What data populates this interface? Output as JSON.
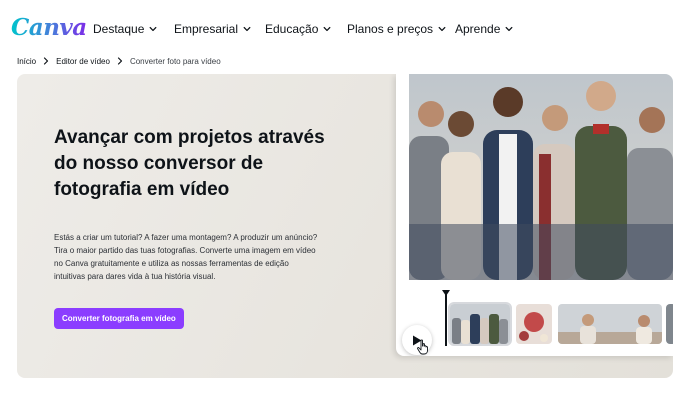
{
  "brand": {
    "logo_text": "Canva"
  },
  "nav": {
    "items": [
      {
        "label": "Destaque"
      },
      {
        "label": "Empresarial"
      },
      {
        "label": "Educação"
      },
      {
        "label": "Planos e preços"
      },
      {
        "label": "Aprende"
      }
    ]
  },
  "breadcrumb": [
    {
      "label": "Início"
    },
    {
      "label": "Editor de vídeo"
    },
    {
      "label": "Converter foto para vídeo"
    }
  ],
  "hero": {
    "title": "Avançar com projetos através do nosso conversor de fotografia em vídeo",
    "description": "Estás a criar um tutorial? A fazer uma montagem? A produzir um anúncio? Tira o maior partido das tuas fotografias. Converte uma imagem em vídeo no Canva gratuitamente e utiliza as nossas ferramentas de edição intuitivas para dares vida à tua história visual.",
    "cta_label": "Converter fotografia em vídeo"
  },
  "colors": {
    "brand_purple": "#8b3dff",
    "hero_bg": "#eeece8",
    "logo_gradient": [
      "#00c4cc",
      "#7d2ae8"
    ]
  },
  "icons": {
    "nav_chevron": "chevron-down-icon",
    "breadcrumb_separator": "chevron-right-icon",
    "play": "play-icon",
    "pointer": "hand-pointer-icon"
  }
}
